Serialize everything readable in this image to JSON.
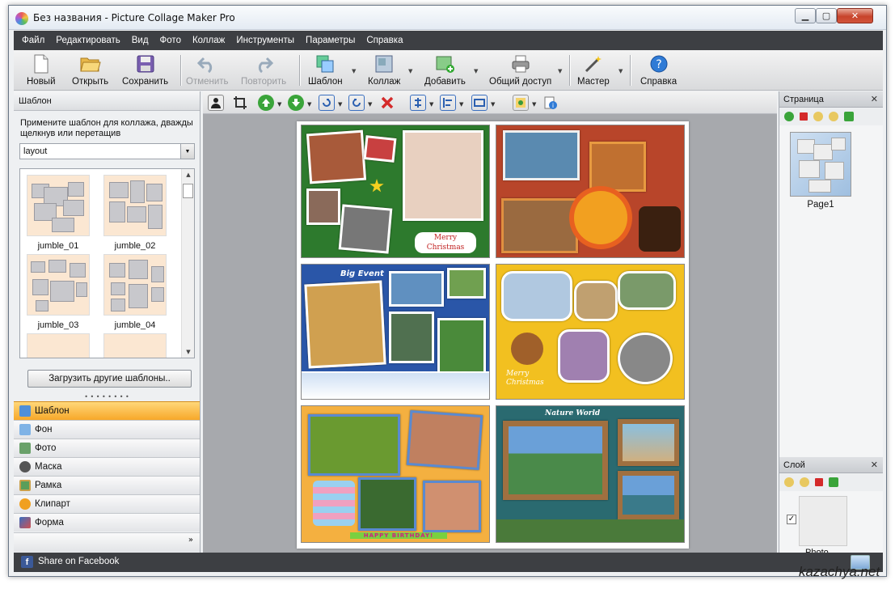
{
  "window": {
    "title": "Без названия - Picture Collage Maker Pro",
    "controls": {
      "minimize": "▁",
      "maximize": "▢",
      "close": "✕"
    }
  },
  "menu": [
    "Файл",
    "Редактировать",
    "Вид",
    "Фото",
    "Коллаж",
    "Инструменты",
    "Параметры",
    "Справка"
  ],
  "toolbar": {
    "new": "Новый",
    "open": "Открыть",
    "save": "Сохранить",
    "undo": "Отменить",
    "redo": "Повторить",
    "template": "Шаблон",
    "collage": "Коллаж",
    "add": "Добавить",
    "share": "Общий доступ",
    "wizard": "Мастер",
    "help": "Справка"
  },
  "left_panel": {
    "header": "Шаблон",
    "description": "Примените шаблон для коллажа, дважды щелкнув или перетащив",
    "select_value": "layout",
    "templates": [
      "jumble_01",
      "jumble_02",
      "jumble_03",
      "jumble_04"
    ],
    "load_button": "Загрузить другие шаблоны..",
    "nav": [
      "Шаблон",
      "Фон",
      "Фото",
      "Маска",
      "Рамка",
      "Клипарт",
      "Форма"
    ],
    "nav_footer": "»"
  },
  "canvas": {
    "texts": {
      "merry_christmas_1": "Merry Christmas",
      "big_event": "Big Event",
      "merry_christmas_2": "Merry Christmas",
      "nature_world": "Nature World",
      "happy_birthday": "HAPPY BIRTHDAY!"
    }
  },
  "right_panel": {
    "page_header": "Страница",
    "page_label": "Page1",
    "layer_header": "Слой",
    "layer_label": "Photo",
    "close_glyph": "✕"
  },
  "status": {
    "share_facebook": "Share on Facebook"
  },
  "watermark": "kazachya.net",
  "colors": {
    "menubar": "#3d3f43",
    "active_nav": "#f7a829",
    "close_button": "#c7432b"
  }
}
